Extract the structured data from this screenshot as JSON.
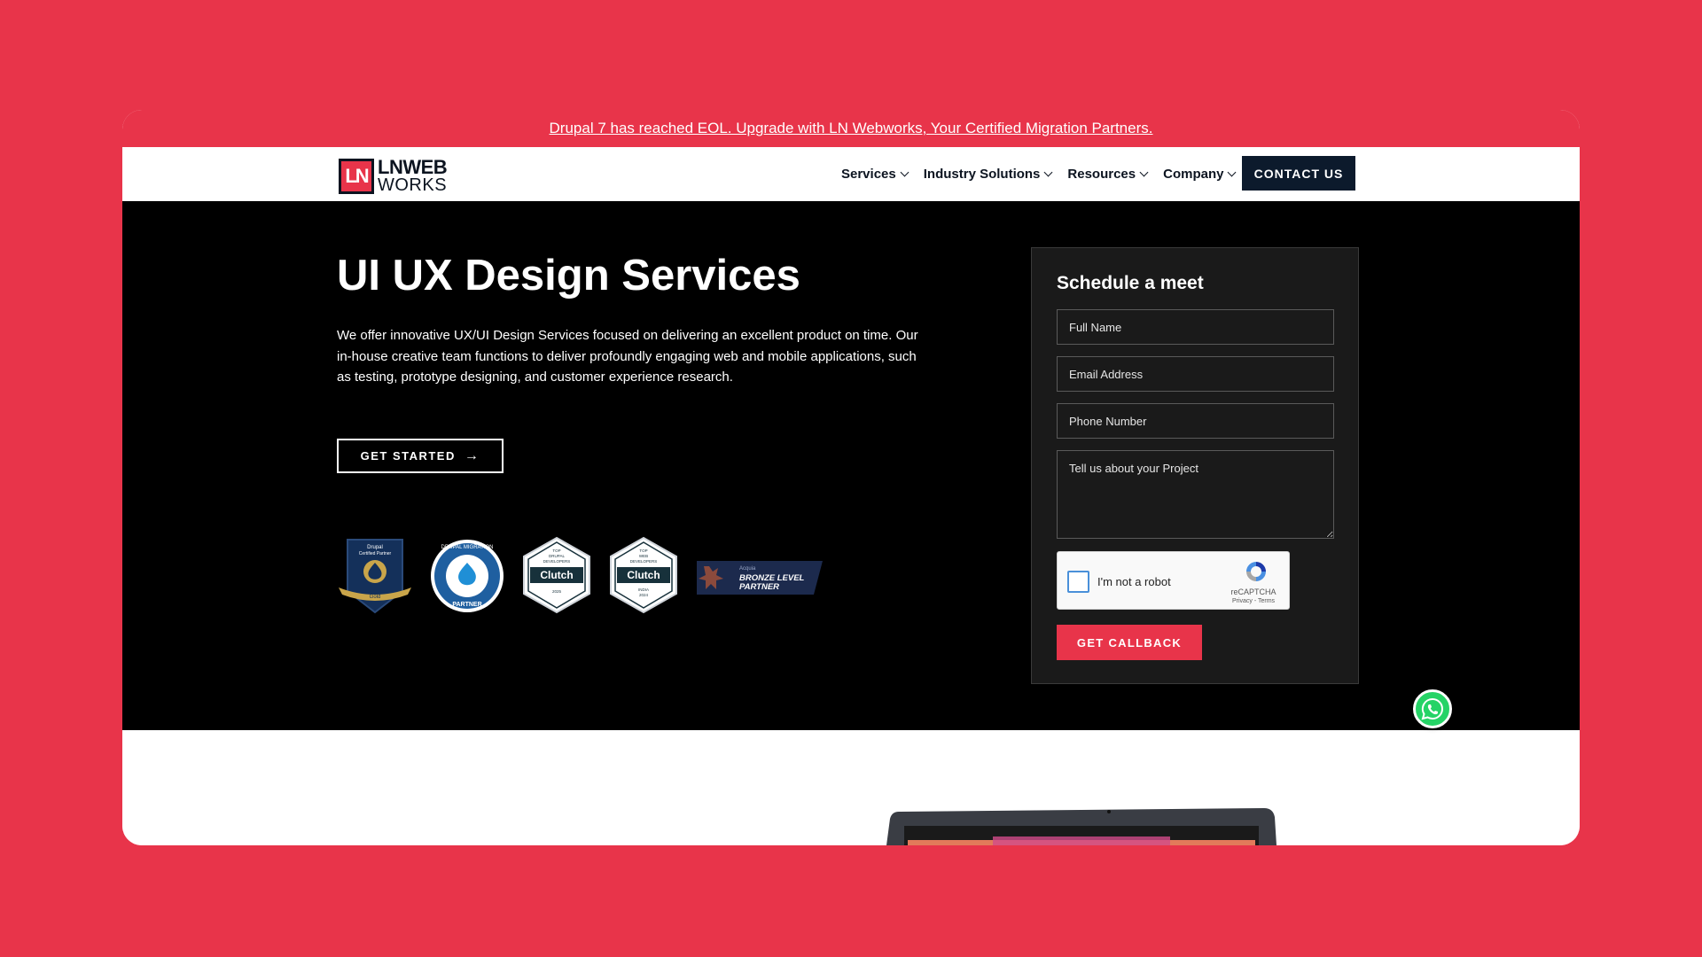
{
  "announcement": {
    "text": "Drupal 7 has reached EOL. Upgrade with LN Webworks, Your Certified Migration Partners."
  },
  "nav": {
    "logo_mark": "LN",
    "logo_line1": "LNWEB",
    "logo_line2": "WORKS",
    "items": [
      {
        "label": "Services"
      },
      {
        "label": "Industry Solutions"
      },
      {
        "label": "Resources"
      },
      {
        "label": "Company"
      }
    ],
    "contact_label": "CONTACT US"
  },
  "hero": {
    "title": "UI UX Design Services",
    "description": "We offer innovative UX/UI Design Services focused on delivering an excellent product on time. Our in-house creative team functions to deliver profoundly engaging web and mobile applications, such as testing, prototype designing, and customer experience research.",
    "cta_label": "GET STARTED"
  },
  "badges": [
    {
      "name": "drupal-certified-partner-badge",
      "lines": [
        "Drupal",
        "Certified Partner"
      ],
      "ribbon": "Gold"
    },
    {
      "name": "drupal-migration-partner-badge",
      "ring_text": "DRUPAL MIGRATION",
      "label": "PARTNER"
    },
    {
      "name": "clutch-top-drupal-developers-badge",
      "top": [
        "TOP",
        "DRUPAL",
        "DEVELOPERS"
      ],
      "brand": "Clutch",
      "bottom": "2025"
    },
    {
      "name": "clutch-top-web-developers-badge",
      "top": [
        "TOP",
        "WEB",
        "DEVELOPERS"
      ],
      "brand": "Clutch",
      "bottom": [
        "INDIA",
        "2024"
      ]
    },
    {
      "name": "acquia-bronze-partner-badge",
      "small": "Acquia",
      "lines": [
        "BRONZE LEVEL",
        "PARTNER"
      ]
    }
  ],
  "form": {
    "title": "Schedule a meet",
    "full_name_placeholder": "Full Name",
    "email_placeholder": "Email Address",
    "phone_placeholder": "Phone Number",
    "project_placeholder": "Tell us about your Project",
    "captcha_label": "I'm not a robot",
    "captcha_brand": "reCAPTCHA",
    "captcha_links": "Privacy - Terms",
    "submit_label": "GET CALLBACK"
  },
  "colors": {
    "brand_red": "#e8344a",
    "navy": "#0c1a2c",
    "whatsapp_green": "#25d366"
  }
}
